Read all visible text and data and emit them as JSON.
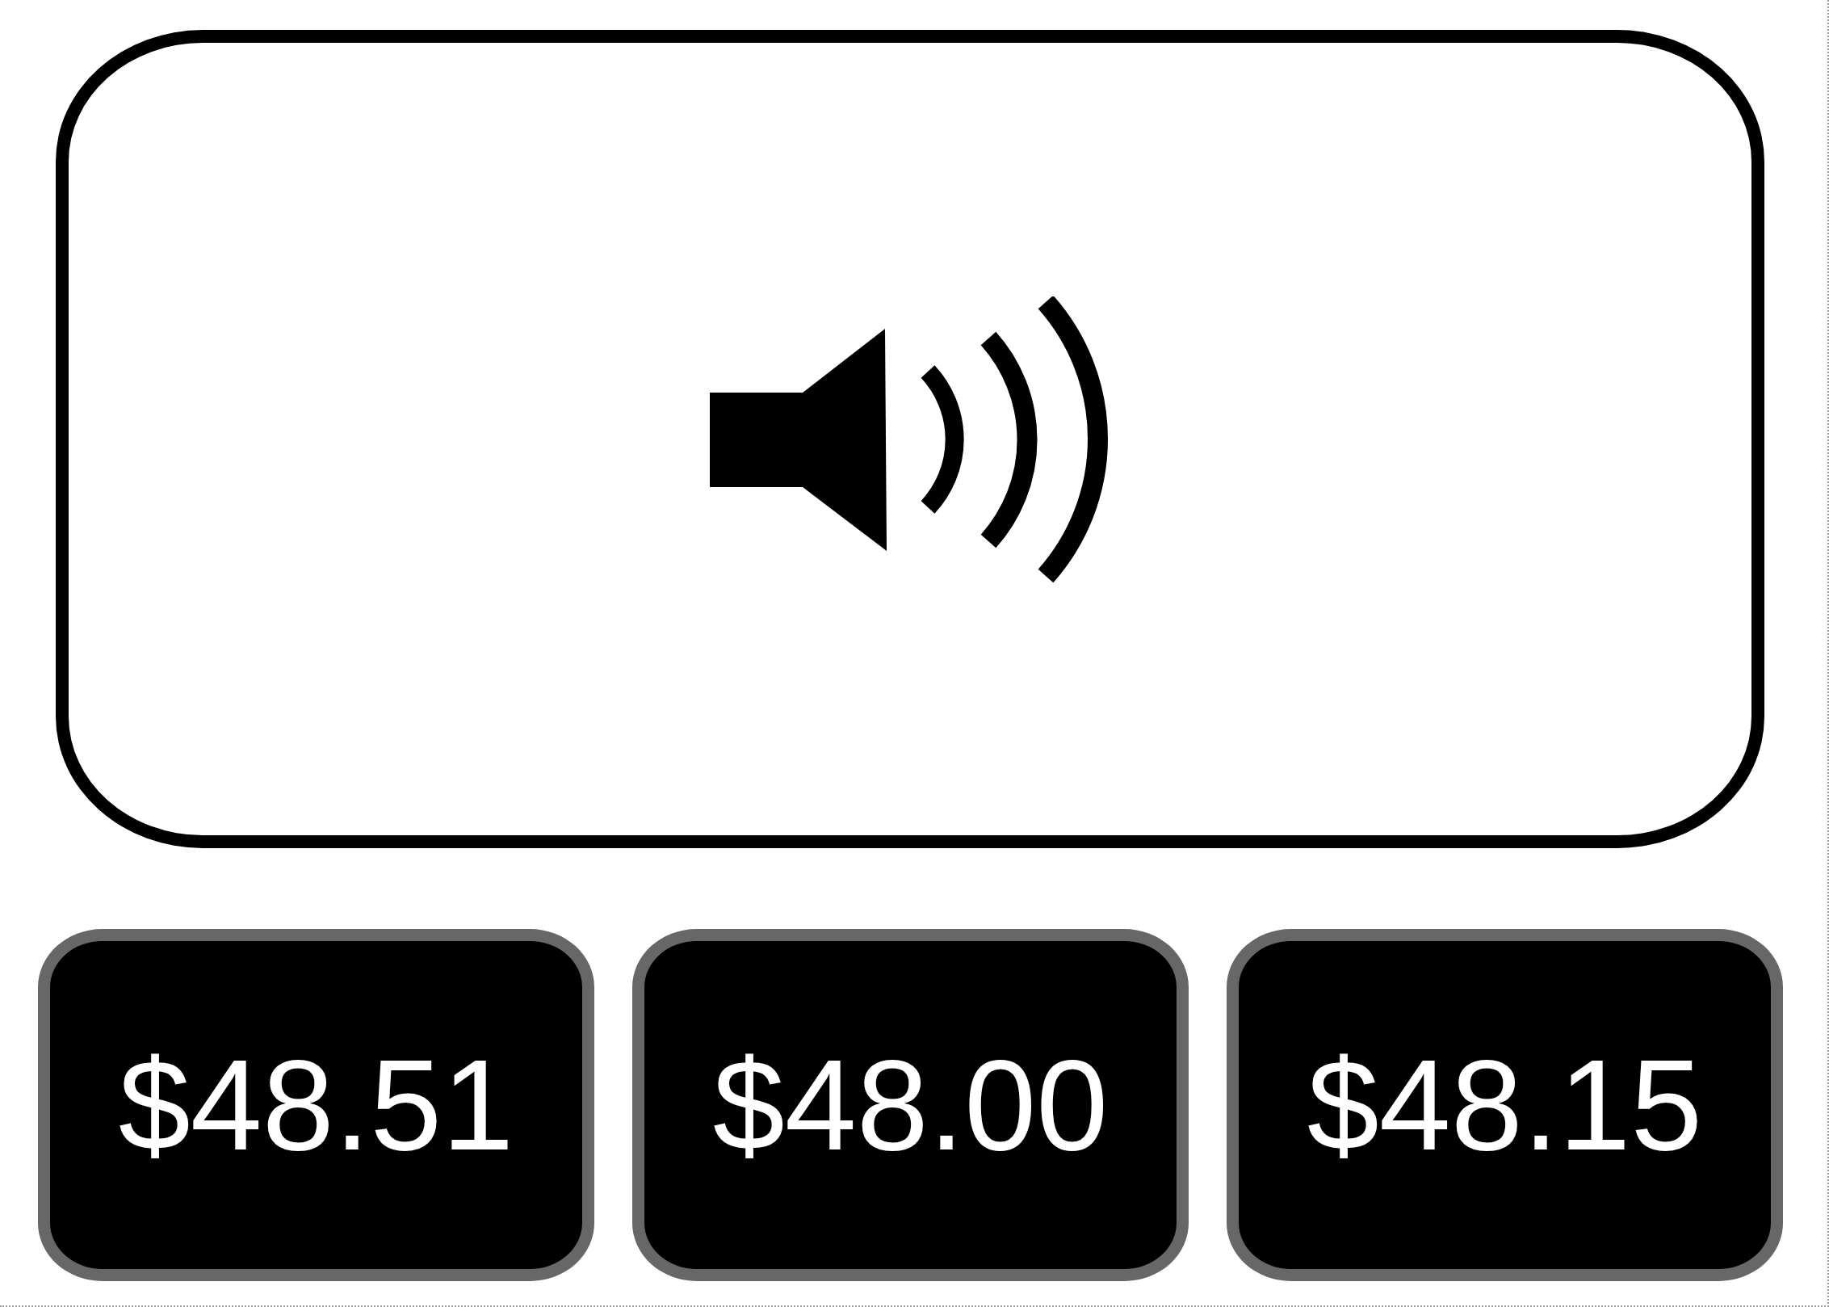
{
  "options": [
    {
      "label": "$48.51",
      "selected": false
    },
    {
      "label": "$48.00",
      "selected": false
    },
    {
      "label": "$48.15",
      "selected": false
    }
  ]
}
